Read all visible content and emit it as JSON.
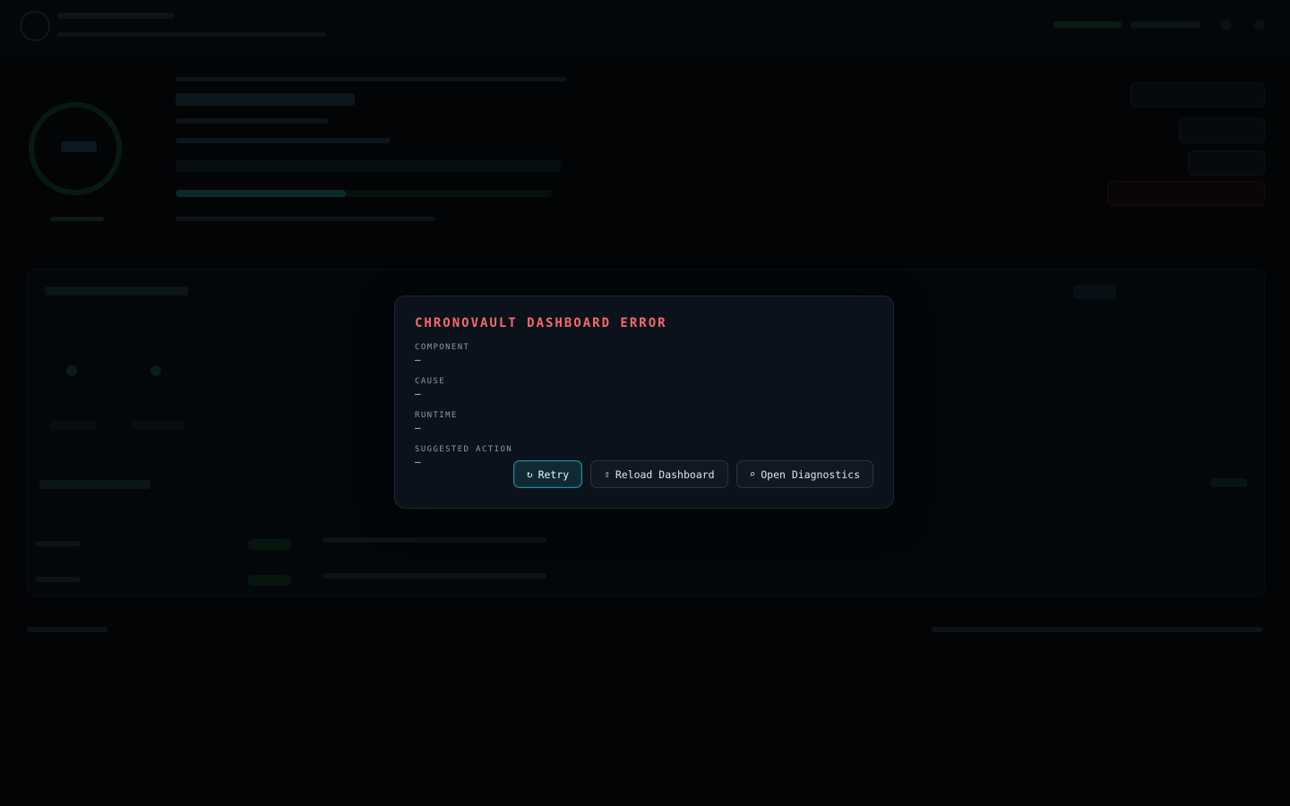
{
  "modal": {
    "title": "CHRONOVAULT DASHBOARD ERROR",
    "fields": [
      {
        "label": "COMPONENT",
        "value": "—"
      },
      {
        "label": "CAUSE",
        "value": "—"
      },
      {
        "label": "RUNTIME",
        "value": "—"
      },
      {
        "label": "SUGGESTED ACTION",
        "value": "—"
      }
    ],
    "actions": {
      "retry": {
        "icon": "↻",
        "label": "Retry"
      },
      "reload": {
        "icon": "⇧",
        "label": "Reload Dashboard"
      },
      "diagnostics": {
        "icon": "⌕",
        "label": "Open Diagnostics"
      }
    }
  },
  "colors": {
    "title": "#f26a6a",
    "accent": "#1f8a9c",
    "modal_bg": "#0c121b"
  }
}
